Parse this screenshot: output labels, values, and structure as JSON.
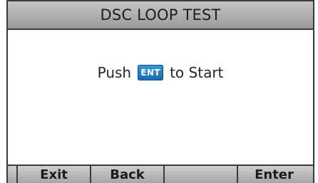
{
  "title": "DSC LOOP TEST",
  "message": {
    "before": "Push",
    "key_label": "ENT",
    "after": "to Start"
  },
  "softkeys": [
    {
      "label": ""
    },
    {
      "label": "Exit"
    },
    {
      "label": "Back"
    },
    {
      "label": ""
    },
    {
      "label": "Enter"
    }
  ],
  "colors": {
    "key_blue": "#1a68b0",
    "frame": "#3a3a3a",
    "bar_gray": "#a6a6a6"
  }
}
